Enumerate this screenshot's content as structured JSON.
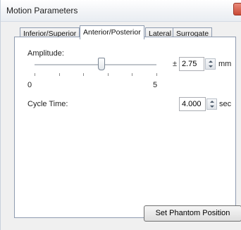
{
  "window": {
    "title": "Motion Parameters"
  },
  "tabs": [
    {
      "label": "Inferior/Superior",
      "active": false
    },
    {
      "label": "Anterior/Posterior",
      "active": true
    },
    {
      "label": "Lateral",
      "active": false
    },
    {
      "label": "Surrogate",
      "active": false
    }
  ],
  "amplitude": {
    "label": "Amplitude:",
    "slider_min_label": "0",
    "slider_max_label": "5",
    "slider_level": 0.55,
    "plus_minus": "±",
    "value": "2.75",
    "unit": "mm"
  },
  "cycle_time": {
    "label": "Cycle Time:",
    "value": "4.000",
    "unit": "sec"
  },
  "buttons": {
    "set_phantom": "Set Phantom Position"
  }
}
